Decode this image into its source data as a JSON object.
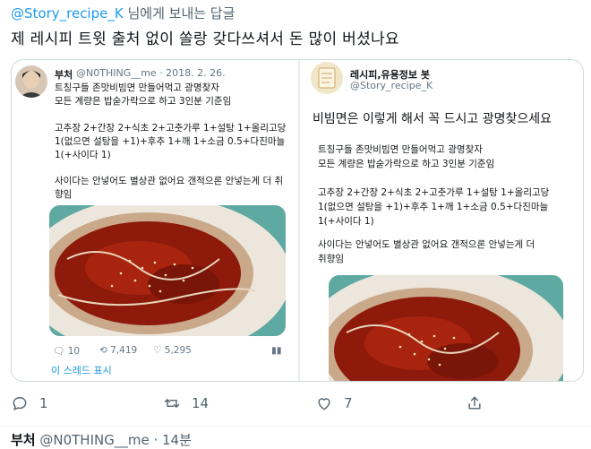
{
  "reply": {
    "mention": "@Story_recipe_K",
    "suffix": " 님에게 보내는 답글"
  },
  "tweet": {
    "text": "제 레시피 트윗 출처 없이 쏠랑 갖다쓰셔서 돈 많이 버셨나요"
  },
  "left_quote": {
    "name": "부처",
    "handle_date": "@N0THING__me · 2018. 2. 26.",
    "lines": [
      "트칭구들 존맛비빔면 만들어먹고 광명찾자",
      "모든 계량은 밥숟가락으로 하고 3인분 기준임",
      "고추장 2+간장 2+식초 2+고춧가루 1+설탕 1+올리고당",
      "1(없으면 설탕을 +1)+후추 1+깨 1+소금 0.5+다진마늘",
      "1(+사이다 1)",
      "사이다는 안넣어도 별상관 없어요 갠적으론 안넣는게 더 취",
      "향임"
    ],
    "stats": {
      "replies": "10",
      "retweets": "7,419",
      "likes": "5,295"
    },
    "thread_link": "이 스레드 표시"
  },
  "right_quote": {
    "name": "레시피,유용정보 봇",
    "handle": "@Story_recipe_K",
    "headline": "비빔면은 이렇게 해서 꼭 드시고 광명찾으세요",
    "lines": [
      "트칭구들 존맛비빔면 만들어먹고 광명찾자",
      "모든 계량은 밥숟가락으로 하고 3인분 기준임",
      "고추장 2+간장 2+식초 2+고춧가루 1+설탕 1+올리고당",
      "1(없으면 설탕을 +1)+후추 1+깨 1+소금 0.5+다진마늘",
      "1(+사이다 1)",
      "사이다는 안넣어도 별상관 없어요 갠적으론 안넣는게 더",
      "취향임"
    ]
  },
  "actions": {
    "reply_count": "1",
    "retweet_count": "14",
    "like_count": "7",
    "share_label": ""
  },
  "next_tweet": {
    "name": "부처",
    "handle": " @N0THING__me · 14분"
  },
  "colors": {
    "accent": "#1d9bf0",
    "muted": "#536471",
    "sauce": "#8e1a0c",
    "plate_teal": "#5fa9a3"
  }
}
